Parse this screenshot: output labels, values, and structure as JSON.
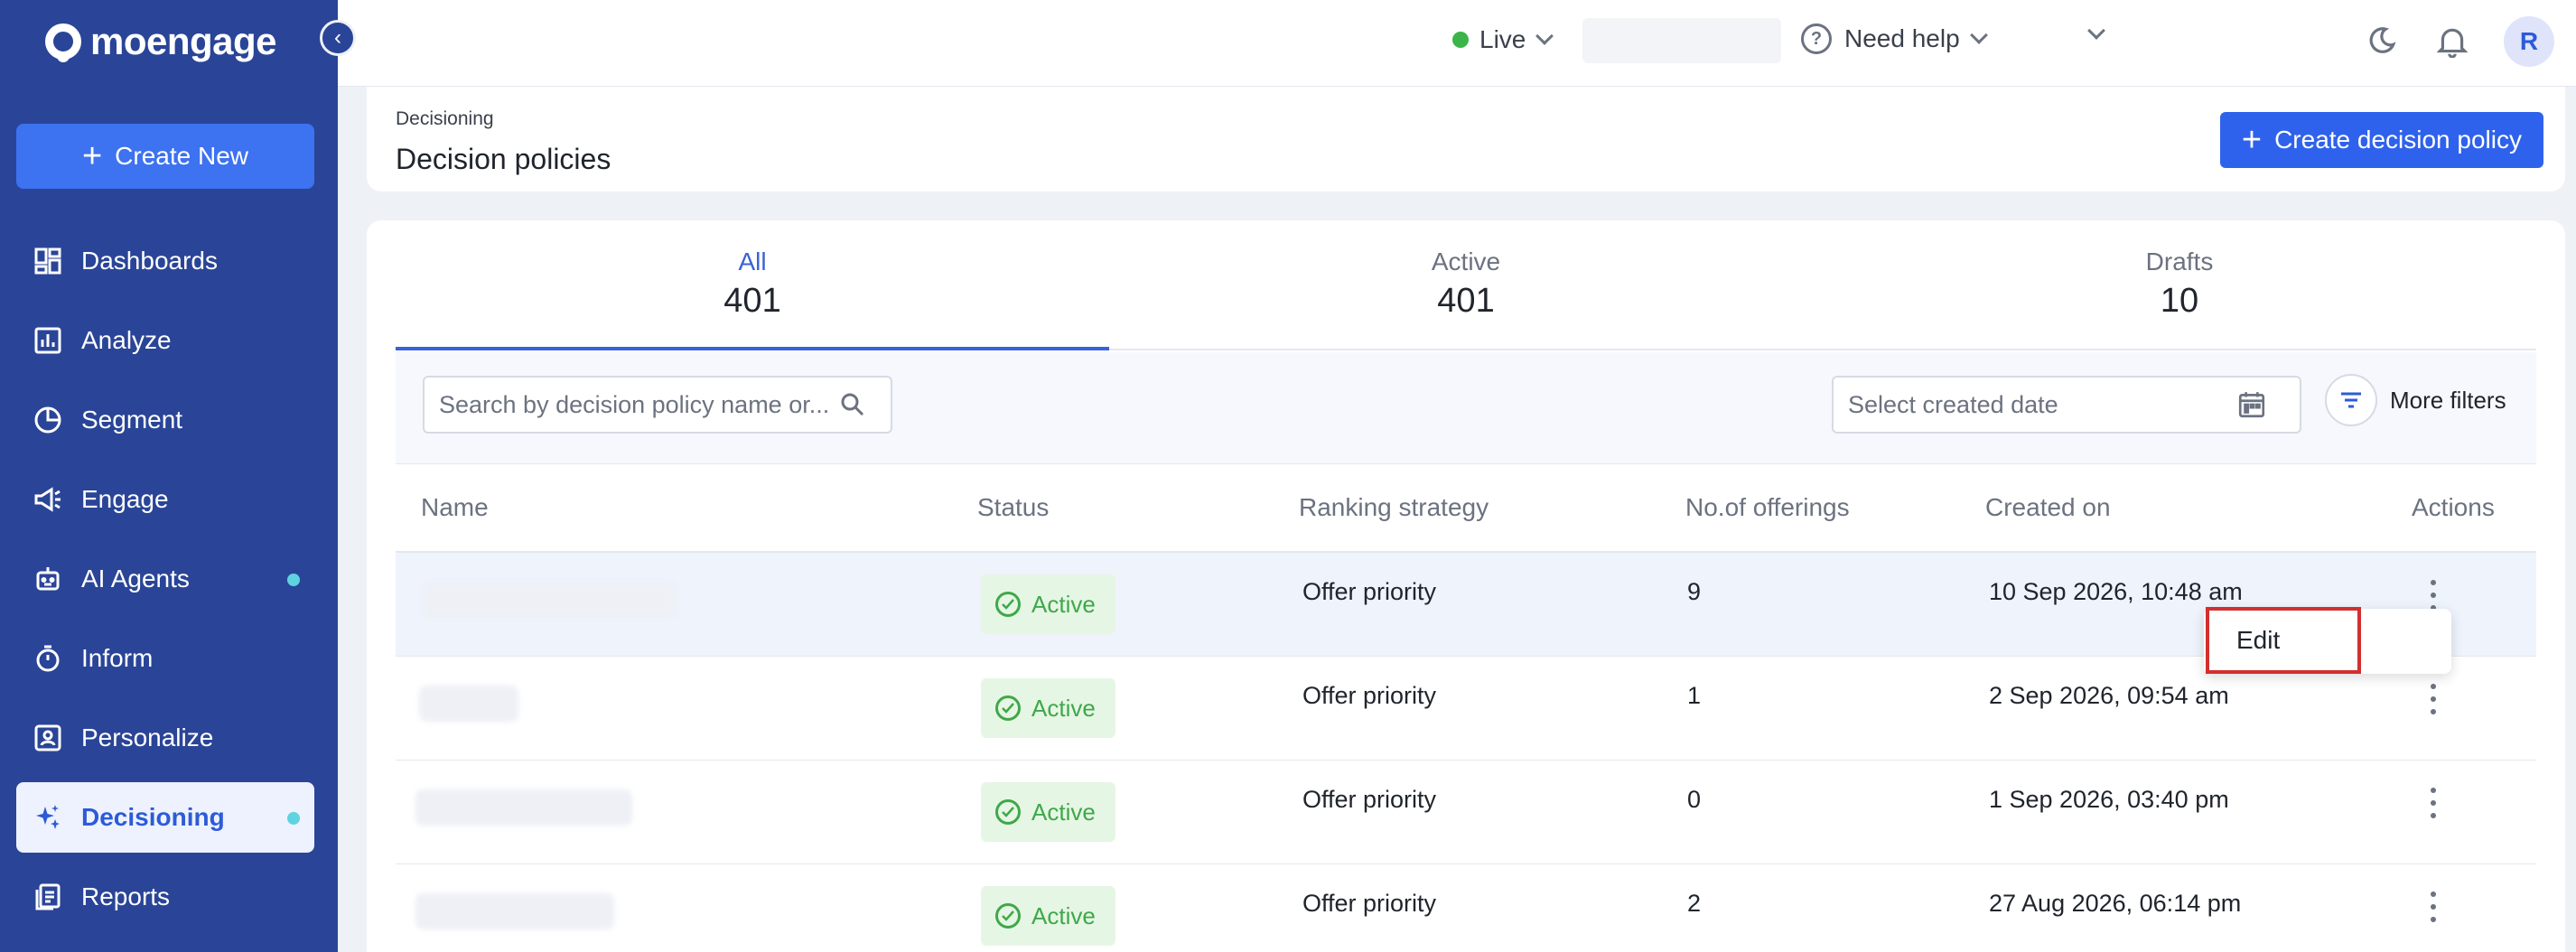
{
  "app": {
    "logo_text": "moengage",
    "brand_color": "#2a4597"
  },
  "sidebar": {
    "create_new_label": "Create New",
    "items": [
      {
        "label": "Dashboards",
        "icon": "dashboards-icon"
      },
      {
        "label": "Analyze",
        "icon": "analyze-icon"
      },
      {
        "label": "Segment",
        "icon": "segment-icon"
      },
      {
        "label": "Engage",
        "icon": "engage-icon"
      },
      {
        "label": "AI Agents",
        "icon": "ai-agents-icon",
        "dot": true
      },
      {
        "label": "Inform",
        "icon": "inform-icon"
      },
      {
        "label": "Personalize",
        "icon": "personalize-icon"
      },
      {
        "label": "Decisioning",
        "icon": "decisioning-icon",
        "active": true,
        "dot": true
      },
      {
        "label": "Reports",
        "icon": "reports-icon"
      }
    ]
  },
  "topbar": {
    "environment": "Live",
    "help_label": "Need help",
    "avatar_initial": "R"
  },
  "header": {
    "breadcrumb": "Decisioning",
    "title": "Decision policies",
    "create_button": "Create decision policy"
  },
  "tabs": [
    {
      "label": "All",
      "count": "401"
    },
    {
      "label": "Active",
      "count": "401"
    },
    {
      "label": "Drafts",
      "count": "10"
    }
  ],
  "filters": {
    "search_placeholder": "Search by decision policy name or...",
    "date_placeholder": "Select created date",
    "more_filters": "More filters"
  },
  "table": {
    "columns": [
      "Name",
      "Status",
      "Ranking strategy",
      "No.of offerings",
      "Created on",
      "Actions"
    ],
    "rows": [
      {
        "status": "Active",
        "ranking": "Offer priority",
        "offerings": "9",
        "created": "10 Sep 2026, 10:48 am"
      },
      {
        "status": "Active",
        "ranking": "Offer priority",
        "offerings": "1",
        "created": "2 Sep 2026, 09:54 am"
      },
      {
        "status": "Active",
        "ranking": "Offer priority",
        "offerings": "0",
        "created": "1 Sep 2026, 03:40 pm"
      },
      {
        "status": "Active",
        "ranking": "Offer priority",
        "offerings": "2",
        "created": "27 Aug 2026, 06:14 pm"
      }
    ]
  },
  "context_menu": {
    "edit_label": "Edit"
  }
}
